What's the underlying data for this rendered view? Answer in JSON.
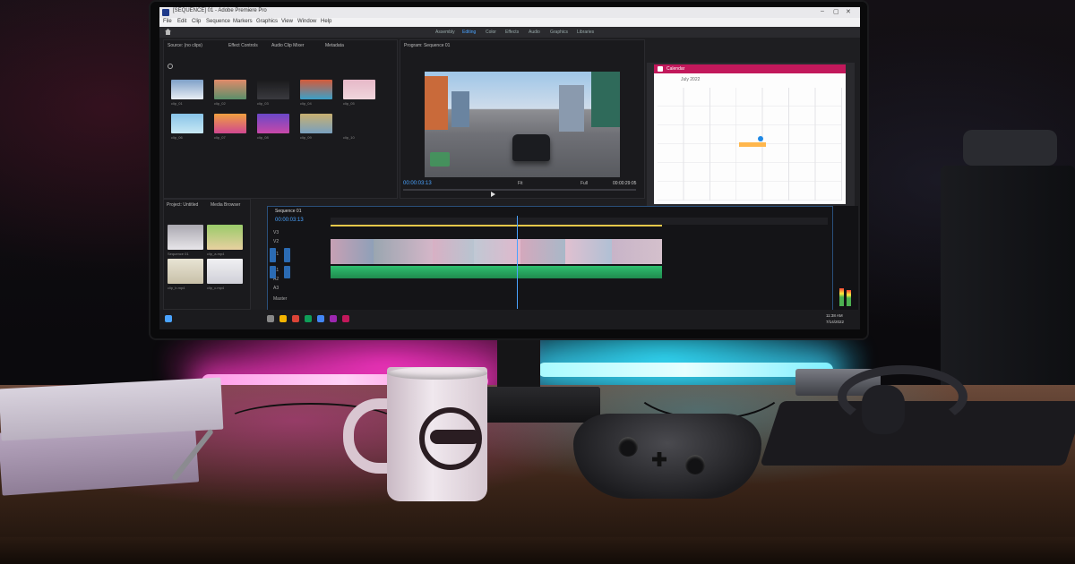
{
  "app": {
    "title": "[SEQUENCE] 01 - Adobe Premiere Pro",
    "menu": [
      "File",
      "Edit",
      "Clip",
      "Sequence",
      "Markers",
      "Graphics",
      "View",
      "Window",
      "Help"
    ],
    "window_controls": [
      "–",
      "▢",
      "✕"
    ]
  },
  "workspaces": {
    "tabs": [
      "Assembly",
      "Editing",
      "Color",
      "Effects",
      "Audio",
      "Graphics",
      "Libraries"
    ],
    "active": "Editing"
  },
  "source_panel": {
    "tabs": [
      "Source: (no clips)",
      "Effect Controls",
      "Audio Clip Mixer",
      "Metadata"
    ],
    "thumbnails": [
      "clip_01",
      "clip_02",
      "clip_03",
      "clip_04",
      "clip_05",
      "clip_06",
      "clip_07",
      "clip_08",
      "clip_09",
      "clip_10"
    ]
  },
  "program_panel": {
    "title": "Program: Sequence 01",
    "timecode_left": "00:00:03:13",
    "timecode_right": "00:00:29:05",
    "zoom": "Fit",
    "quality": "Full"
  },
  "calendar": {
    "title": "Calendar",
    "month": "July 2022"
  },
  "project_panel": {
    "tabs": [
      "Project: Untitled",
      "Media Browser"
    ],
    "items": [
      "Sequence 01",
      "clip_a.mp4",
      "clip_b.mp4",
      "clip_c.mp4"
    ]
  },
  "timeline": {
    "tab": "Sequence 01",
    "timecode": "00:00:03:13",
    "tracks": [
      "V3",
      "V2",
      "V1",
      "A1",
      "A2",
      "A3",
      "Master"
    ]
  },
  "taskbar": {
    "time": "11:38 AM",
    "date": "7/14/2022"
  },
  "icons": {
    "home": "home-icon",
    "search": "search-icon",
    "play": "play-icon",
    "calendar": "calendar-icon",
    "controller": "gamepad-icon",
    "mug": "mug-icon"
  },
  "colors": {
    "neon_pink": "#ff3cc8",
    "neon_cyan": "#3ce6ff",
    "accent_blue": "#4aa3ff",
    "calendar_header": "#c2185b"
  }
}
